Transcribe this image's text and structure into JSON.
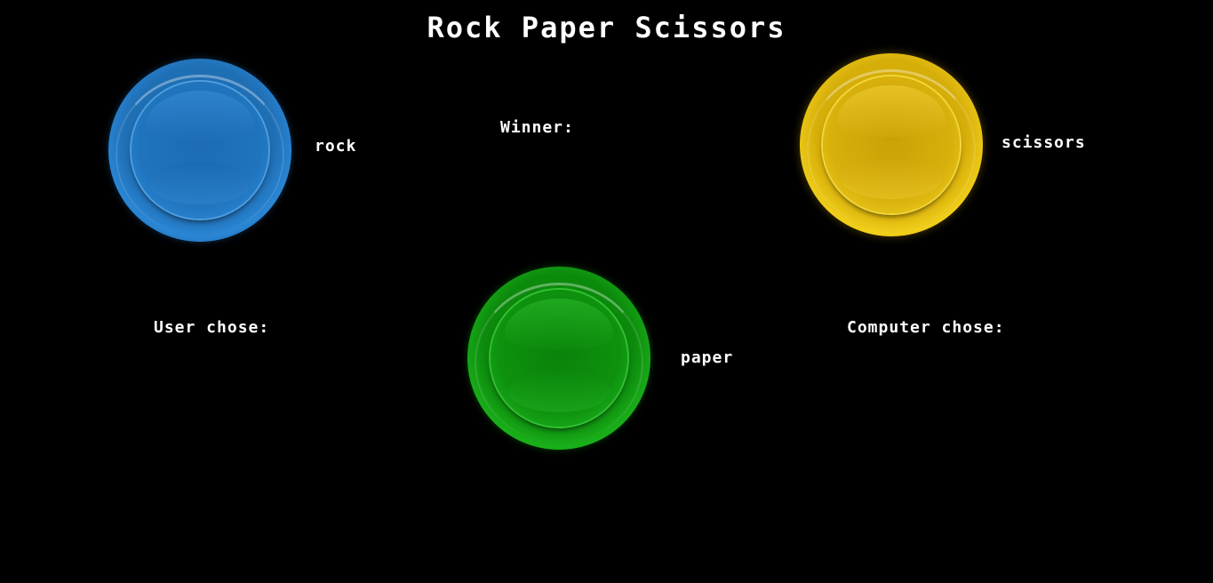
{
  "title": "Rock Paper Scissors",
  "buttons": {
    "rock": {
      "label": "rock",
      "color": "#1f74bd"
    },
    "paper": {
      "label": "paper",
      "color": "#0e920e"
    },
    "scissors": {
      "label": "scissors",
      "color": "#d8b00c"
    }
  },
  "status": {
    "winner_label": "Winner:",
    "user_label": "User chose:",
    "computer_label": "Computer chose:"
  },
  "colors": {
    "background": "#000000",
    "text": "#ffffff"
  }
}
